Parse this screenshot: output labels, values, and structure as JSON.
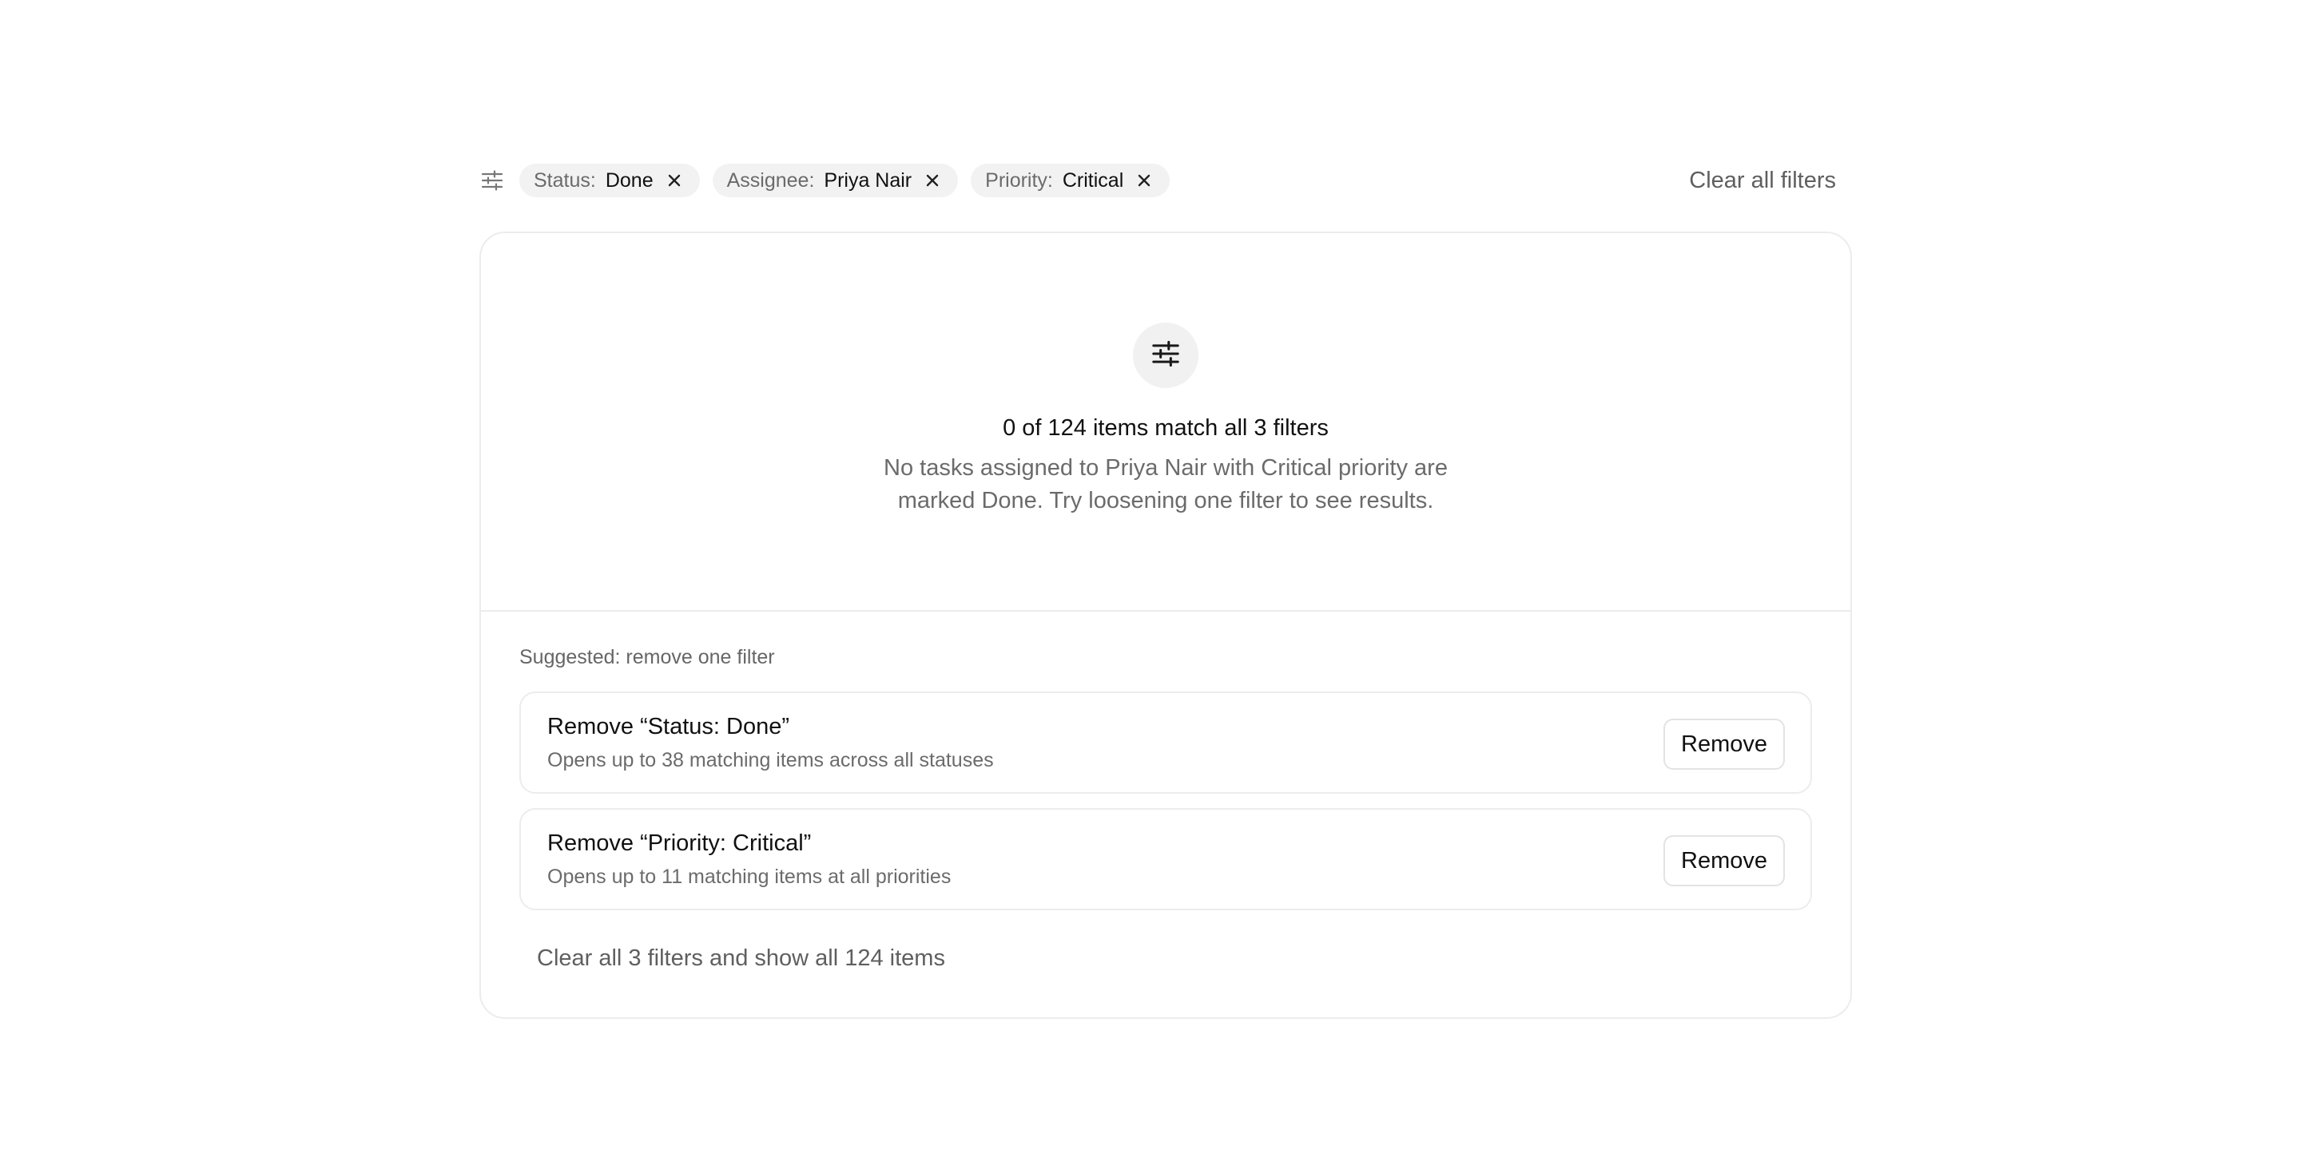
{
  "filter_bar": {
    "icon": "filter-sliders-icon",
    "chips": [
      {
        "key": "Status:",
        "value": "Done",
        "remove_icon": "close-icon"
      },
      {
        "key": "Assignee:",
        "value": "Priya Nair",
        "remove_icon": "close-icon"
      },
      {
        "key": "Priority:",
        "value": "Critical",
        "remove_icon": "close-icon"
      }
    ],
    "clear_all_label": "Clear all filters"
  },
  "empty_state": {
    "icon": "filter-sliders-icon",
    "title": "0 of 124 items match all 3 filters",
    "description": "No tasks assigned to Priya Nair with Critical priority are marked Done. Try loosening one filter to see results."
  },
  "suggestions": {
    "label": "Suggested: remove one filter",
    "items": [
      {
        "title": "Remove “Status: Done”",
        "subtitle": "Opens up to 38 matching items across all statuses",
        "button_label": "Remove"
      },
      {
        "title": "Remove “Priority: Critical”",
        "subtitle": "Opens up to 11 matching items at all priorities",
        "button_label": "Remove"
      }
    ],
    "clear_all_label": "Clear all 3 filters and show all 124 items"
  },
  "colors": {
    "chip_bg": "#f2f2f2",
    "border": "#ececec",
    "muted_text": "#6b6b6b",
    "text": "#111111"
  }
}
